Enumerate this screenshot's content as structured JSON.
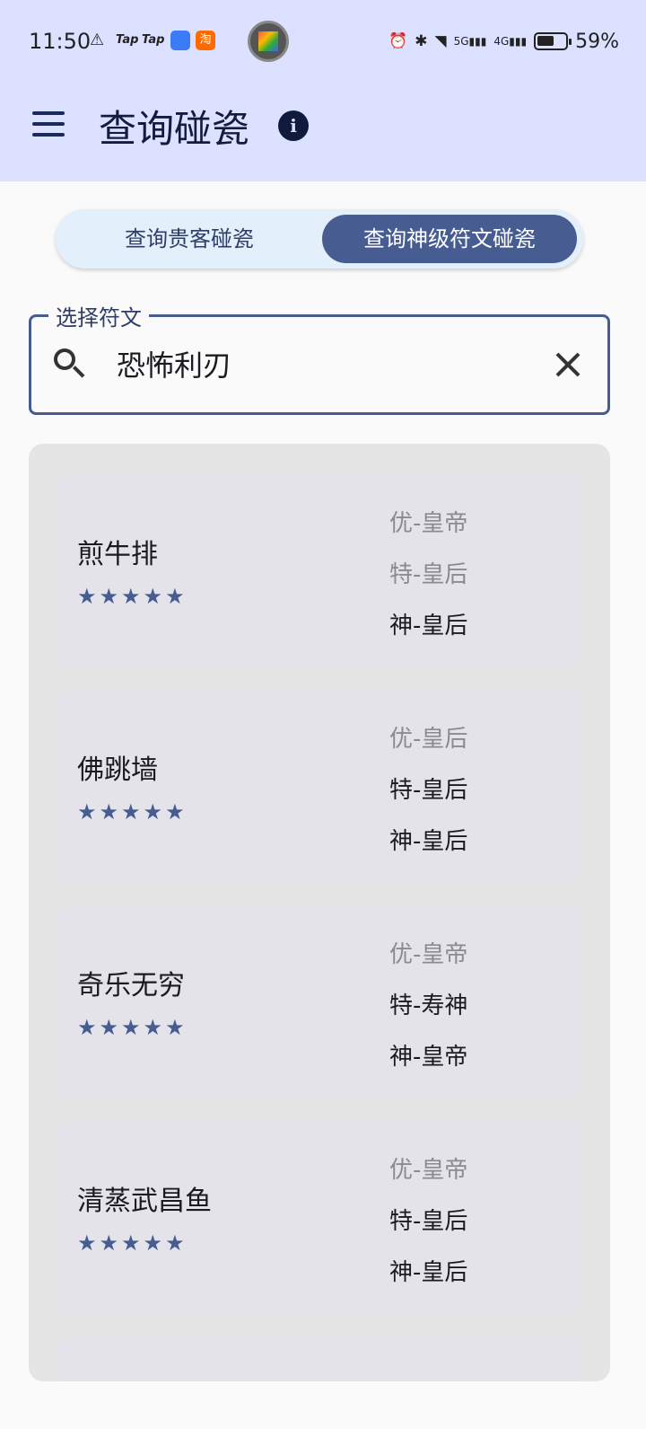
{
  "status_bar": {
    "time": "11:50",
    "taptap_1": "Tap",
    "taptap_2": "Tap",
    "taobao_glyph": "淘",
    "battery": "59%",
    "signal_5g": "5G",
    "signal_4g": "4G"
  },
  "app_bar": {
    "title": "查询碰瓷",
    "info_icon": "i"
  },
  "tabs": [
    {
      "label": "查询贵客碰瓷",
      "selected": false
    },
    {
      "label": "查询神级符文碰瓷",
      "selected": true
    }
  ],
  "search": {
    "label": "选择符文",
    "value": "恐怖利刃"
  },
  "results": [
    {
      "name": "煎牛排",
      "stars": "★★★★★",
      "levels": [
        "优-皇帝",
        "特-皇后",
        "神-皇后"
      ]
    },
    {
      "name": "佛跳墙",
      "stars": "★★★★★",
      "levels": [
        "优-皇后",
        "特-皇后",
        "神-皇后"
      ]
    },
    {
      "name": "奇乐无穷",
      "stars": "★★★★★",
      "levels": [
        "优-皇帝",
        "特-寿神",
        "神-皇帝"
      ]
    },
    {
      "name": "清蒸武昌鱼",
      "stars": "★★★★★",
      "levels": [
        "优-皇帝",
        "特-皇后",
        "神-皇后"
      ]
    }
  ],
  "colors": {
    "header_bg": "#dbe1ff",
    "accent": "#475d92",
    "segment_bg": "#e3f0fb",
    "card_bg": "#e3e3e9",
    "panel_bg": "#e5e5e5"
  }
}
